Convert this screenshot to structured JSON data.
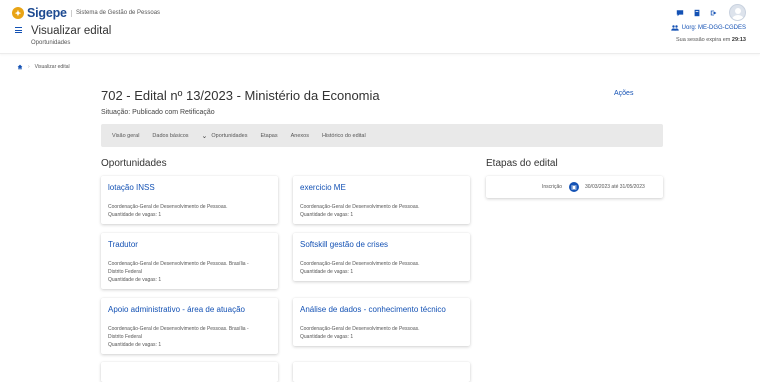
{
  "header": {
    "logo_text": "Sigepe",
    "system_name": "Sistema de Gestão de Pessoas",
    "page_title": "Visualizar edital",
    "page_subtitle": "Oportunidades",
    "org": "Uorg: ME-DGG-CGDES",
    "session_prefix": "Sua sessão expira em",
    "session_time": "29:13",
    "icons": [
      "chat-icon",
      "book-icon",
      "logout-icon"
    ]
  },
  "breadcrumb": {
    "current": "Visualizar edital"
  },
  "edital": {
    "title": "702 - Edital nº 13/2023 - Ministério da Economia",
    "acoes": "Ações",
    "situacao": "Situação: Publicado com Retificação"
  },
  "tabs": [
    "Visão geral",
    "Dados básicos",
    "Oportunidades",
    "Etapas",
    "Anexos",
    "Histórico do edital"
  ],
  "sections": {
    "oportunidades": "Oportunidades",
    "etapas": "Etapas do edital"
  },
  "opportunities": [
    {
      "title": "lotação INSS",
      "line1": "Coordenação-Geral de Desenvolvimento de Pessoas.",
      "line2": "",
      "vagas": "Quantidade de vagas: 1"
    },
    {
      "title": "exercicio ME",
      "line1": "Coordenação-Geral de Desenvolvimento de Pessoas.",
      "line2": "",
      "vagas": "Quantidade de vagas: 1"
    },
    {
      "title": "Tradutor",
      "line1": "Coordenação-Geral de Desenvolvimento de Pessoas. Brasília -",
      "line2": "Distrito Federal",
      "vagas": "Quantidade de vagas: 1"
    },
    {
      "title": "Softskill gestão de crises",
      "line1": "Coordenação-Geral de Desenvolvimento de Pessoas.",
      "line2": "",
      "vagas": "Quantidade de vagas: 1"
    },
    {
      "title": "Apoio administrativo - área de atuação",
      "line1": "Coordenação-Geral de Desenvolvimento de Pessoas. Brasília -",
      "line2": "Distrito Federal",
      "vagas": "Quantidade de vagas: 1"
    },
    {
      "title": "Análise de dados - conhecimento técnico",
      "line1": "Coordenação-Geral de Desenvolvimento de Pessoas.",
      "line2": "",
      "vagas": "Quantidade de vagas: 1"
    }
  ],
  "etapa": {
    "label": "Inscrição",
    "dates": "30/03/2023 até 31/05/2023"
  },
  "colors": {
    "primary": "#1351b4",
    "logo_accent": "#e8a416"
  }
}
